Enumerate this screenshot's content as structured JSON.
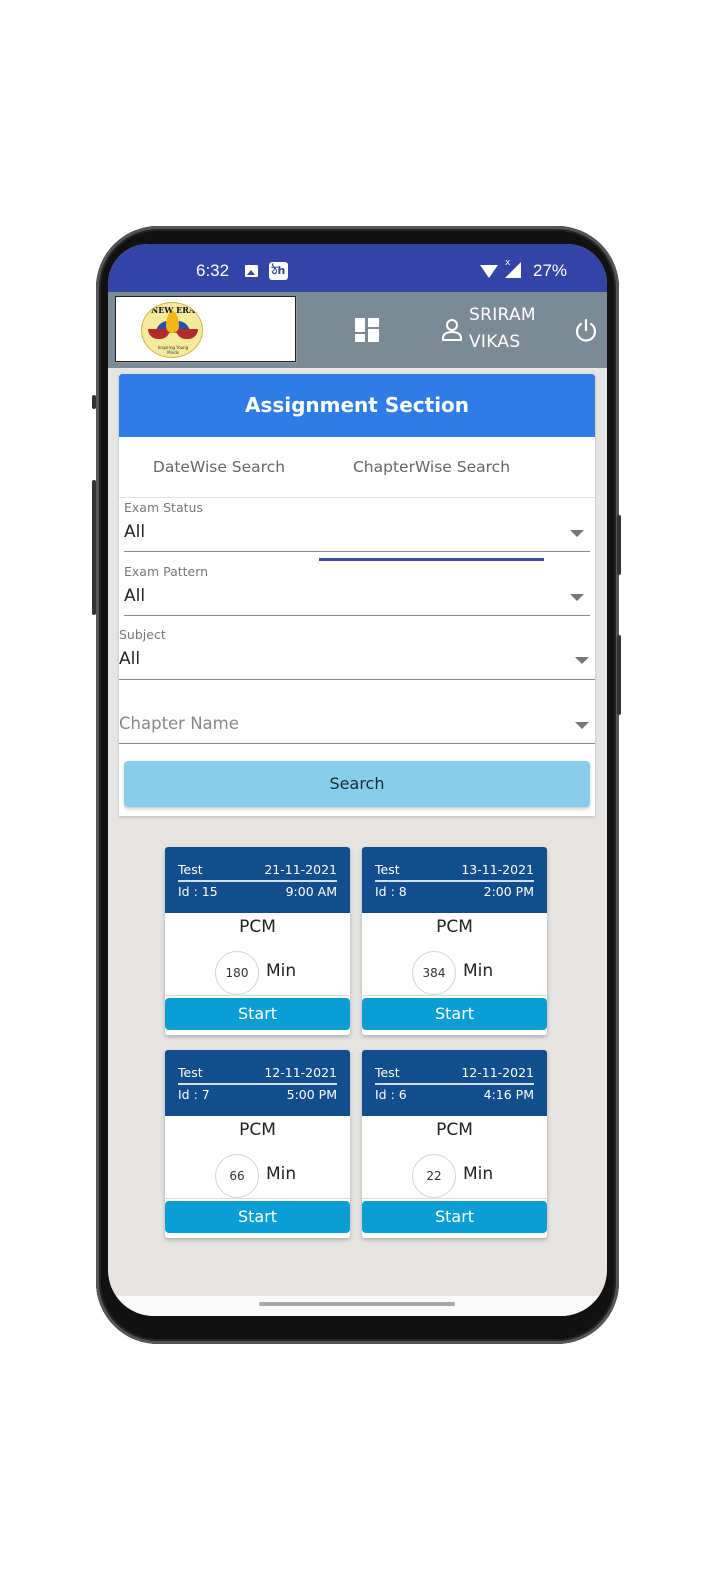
{
  "status_bar": {
    "time": "6:32",
    "app_icon_text": "ঠh",
    "battery": "27%",
    "signal_badge": "x",
    "icons": [
      "image-icon",
      "app-icon",
      "wifi-icon",
      "signal-icon"
    ]
  },
  "app_bar": {
    "logo_text": "NEW ERA",
    "logo_tagline": "Inspiring Young Minds",
    "user_name_line1": "SRIRAM",
    "user_name_line2": "VIKAS",
    "icons": [
      "dashboard-icon",
      "user-icon",
      "power-icon"
    ]
  },
  "section": {
    "title": "Assignment Section",
    "tabs": [
      {
        "label": "DateWise Search",
        "active": false
      },
      {
        "label": "ChapterWise Search",
        "active": true
      }
    ]
  },
  "filters": {
    "exam_status": {
      "label": "Exam Status",
      "value": "All"
    },
    "exam_pattern": {
      "label": "Exam Pattern",
      "value": "All"
    },
    "subject": {
      "label": "Subject",
      "value": "All"
    },
    "chapter_name": {
      "placeholder": "Chapter Name",
      "value": ""
    },
    "search_label": "Search"
  },
  "tests": [
    {
      "type": "Test",
      "date": "21-11-2021",
      "id": "Id : 15",
      "time": "9:00 AM",
      "subject": "PCM",
      "duration": "180",
      "unit": "Min",
      "action": "Start"
    },
    {
      "type": "Test",
      "date": "13-11-2021",
      "id": "Id : 8",
      "time": "2:00 PM",
      "subject": "PCM",
      "duration": "384",
      "unit": "Min",
      "action": "Start"
    },
    {
      "type": "Test",
      "date": "12-11-2021",
      "id": "Id : 7",
      "time": "5:00 PM",
      "subject": "PCM",
      "duration": "66",
      "unit": "Min",
      "action": "Start"
    },
    {
      "type": "Test",
      "date": "12-11-2021",
      "id": "Id : 6",
      "time": "4:16 PM",
      "subject": "PCM",
      "duration": "22",
      "unit": "Min",
      "action": "Start"
    }
  ],
  "colors": {
    "status_bar": "#3343a6",
    "app_bar": "#7b8b96",
    "header_band": "#2f7ce6",
    "tab_indicator": "#3b4ea5",
    "search_button": "#87ceea",
    "card_header": "#124d8e",
    "start_button": "#0b9ed4"
  }
}
